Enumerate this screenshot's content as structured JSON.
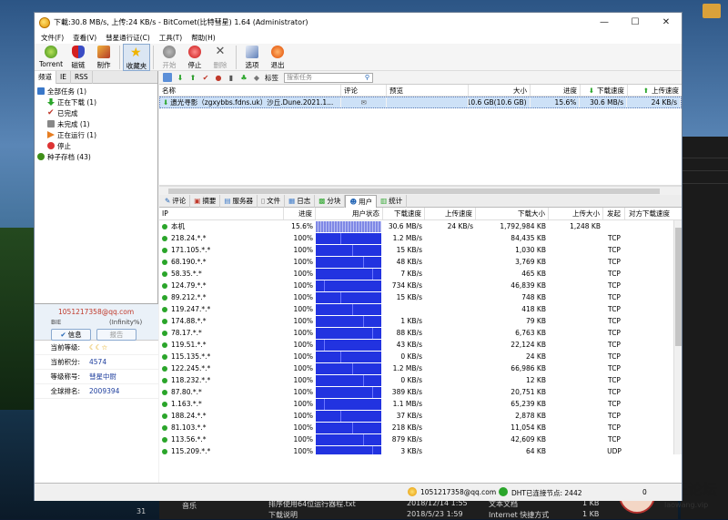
{
  "window": {
    "title": "下載:30.8 MB/s, 上传:24 KB/s - BitComet(比特彗星) 1.64 (Administrator)",
    "minimize": "—",
    "maximize": "☐",
    "close": "✕"
  },
  "menu": [
    "文件(F)",
    "查看(V)",
    "彗星通行证(C)",
    "工具(T)",
    "帮助(H)"
  ],
  "toolbar": [
    {
      "label": "Torrent",
      "icon": "torrent-icon"
    },
    {
      "label": "磁链",
      "icon": "magnet-icon"
    },
    {
      "label": "制作",
      "icon": "make-torrent-icon"
    },
    {
      "label": "收藏夹",
      "icon": "favorites-star-icon"
    },
    {
      "label": "开始",
      "icon": "start-icon"
    },
    {
      "label": "停止",
      "icon": "stop-icon"
    },
    {
      "label": "删除",
      "icon": "delete-icon"
    },
    {
      "label": "选项",
      "icon": "options-icon"
    },
    {
      "label": "退出",
      "icon": "exit-icon"
    }
  ],
  "left_tabs": [
    "频道",
    "IE",
    "RSS"
  ],
  "tree": [
    {
      "label": "全部任务 (1)",
      "level": 0
    },
    {
      "label": "正在下载 (1)",
      "level": 1
    },
    {
      "label": "已完成",
      "level": 1
    },
    {
      "label": "未完成 (1)",
      "level": 1
    },
    {
      "label": "正在运行 (1)",
      "level": 1
    },
    {
      "label": "停止",
      "level": 1
    },
    {
      "label": "种子存档 (43)",
      "level": 0
    }
  ],
  "user": {
    "email": "1051217358@qq.com",
    "nick_left": "BIE",
    "nick_right": "(Infinity%)",
    "info_btn": "信息",
    "report_btn": "报告",
    "stats": [
      {
        "k": "当前等级:",
        "v": "☾☾☆"
      },
      {
        "k": "当前积分:",
        "v": "4574"
      },
      {
        "k": "等级称号:",
        "v": "彗星中尉"
      },
      {
        "k": "全球排名:",
        "v": "2009394"
      }
    ]
  },
  "task_toolbar": {
    "tag_label": "标签",
    "search_placeholder": "搜索任务"
  },
  "task_columns": [
    "名称",
    "评论",
    "预览",
    "大小",
    "进度",
    "下载速度",
    "上传速度"
  ],
  "tasks": [
    {
      "name": "遗光寻影（zgxybbs.fdns.uk）沙丘.Dune.2021.1...",
      "comment": "✉",
      "preview": "",
      "size": "10.6 GB(10.6 GB)",
      "progress": "15.6%",
      "down": "30.6 MB/s",
      "up": "24 KB/s"
    }
  ],
  "bottom_tabs": [
    "评论",
    "摘要",
    "服务器",
    "文件",
    "日志",
    "分块",
    "用户",
    "统计"
  ],
  "peer_columns": [
    "IP",
    "进度",
    "用户状态",
    "下载速度",
    "上传速度",
    "下载大小",
    "上传大小",
    "发起",
    "对方下载速度"
  ],
  "peers": [
    {
      "ip": "本机",
      "progress": "15.6%",
      "fill": 1.0,
      "self": true,
      "down": "30.6 MB/s",
      "up": "24 KB/s",
      "dsize": "1,792,984 KB",
      "usize": "1,248 KB",
      "init": ""
    },
    {
      "ip": "218.24.*.*",
      "progress": "100%",
      "fill": 1.0,
      "down": "1.2 MB/s",
      "up": "",
      "dsize": "84,435 KB",
      "usize": "",
      "init": "TCP"
    },
    {
      "ip": "171.105.*.*",
      "progress": "100%",
      "fill": 1.0,
      "down": "15 KB/s",
      "up": "",
      "dsize": "1,030 KB",
      "usize": "",
      "init": "TCP"
    },
    {
      "ip": "68.190.*.*",
      "progress": "100%",
      "fill": 1.0,
      "down": "48 KB/s",
      "up": "",
      "dsize": "3,769 KB",
      "usize": "",
      "init": "TCP"
    },
    {
      "ip": "58.35.*.*",
      "progress": "100%",
      "fill": 1.0,
      "down": "7 KB/s",
      "up": "",
      "dsize": "465 KB",
      "usize": "",
      "init": "TCP"
    },
    {
      "ip": "124.79.*.*",
      "progress": "100%",
      "fill": 1.0,
      "down": "734 KB/s",
      "up": "",
      "dsize": "46,839 KB",
      "usize": "",
      "init": "TCP"
    },
    {
      "ip": "89.212.*.*",
      "progress": "100%",
      "fill": 1.0,
      "down": "15 KB/s",
      "up": "",
      "dsize": "748 KB",
      "usize": "",
      "init": "TCP"
    },
    {
      "ip": "119.247.*.*",
      "progress": "100%",
      "fill": 1.0,
      "down": "",
      "up": "",
      "dsize": "418 KB",
      "usize": "",
      "init": "TCP"
    },
    {
      "ip": "174.88.*.*",
      "progress": "100%",
      "fill": 1.0,
      "down": "1 KB/s",
      "up": "",
      "dsize": "79 KB",
      "usize": "",
      "init": "TCP"
    },
    {
      "ip": "78.17.*.*",
      "progress": "100%",
      "fill": 1.0,
      "down": "88 KB/s",
      "up": "",
      "dsize": "6,763 KB",
      "usize": "",
      "init": "TCP"
    },
    {
      "ip": "119.51.*.*",
      "progress": "100%",
      "fill": 1.0,
      "down": "43 KB/s",
      "up": "",
      "dsize": "22,124 KB",
      "usize": "",
      "init": "TCP"
    },
    {
      "ip": "115.135.*.*",
      "progress": "100%",
      "fill": 1.0,
      "down": "0 KB/s",
      "up": "",
      "dsize": "24 KB",
      "usize": "",
      "init": "TCP"
    },
    {
      "ip": "122.245.*.*",
      "progress": "100%",
      "fill": 1.0,
      "down": "1.2 MB/s",
      "up": "",
      "dsize": "66,986 KB",
      "usize": "",
      "init": "TCP"
    },
    {
      "ip": "118.232.*.*",
      "progress": "100%",
      "fill": 1.0,
      "down": "0 KB/s",
      "up": "",
      "dsize": "12 KB",
      "usize": "",
      "init": "TCP"
    },
    {
      "ip": "87.80.*.*",
      "progress": "100%",
      "fill": 1.0,
      "down": "389 KB/s",
      "up": "",
      "dsize": "20,751 KB",
      "usize": "",
      "init": "TCP"
    },
    {
      "ip": "1.163.*.*",
      "progress": "100%",
      "fill": 1.0,
      "down": "1.1 MB/s",
      "up": "",
      "dsize": "65,239 KB",
      "usize": "",
      "init": "TCP"
    },
    {
      "ip": "188.24.*.*",
      "progress": "100%",
      "fill": 1.0,
      "down": "37 KB/s",
      "up": "",
      "dsize": "2,878 KB",
      "usize": "",
      "init": "TCP"
    },
    {
      "ip": "81.103.*.*",
      "progress": "100%",
      "fill": 1.0,
      "down": "218 KB/s",
      "up": "",
      "dsize": "11,054 KB",
      "usize": "",
      "init": "TCP"
    },
    {
      "ip": "113.56.*.*",
      "progress": "100%",
      "fill": 1.0,
      "down": "879 KB/s",
      "up": "",
      "dsize": "42,609 KB",
      "usize": "",
      "init": "TCP"
    },
    {
      "ip": "115.209.*.*",
      "progress": "100%",
      "fill": 1.0,
      "down": "3 KB/s",
      "up": "",
      "dsize": "64 KB",
      "usize": "",
      "init": "UDP"
    }
  ],
  "status": {
    "email": "1051217358@qq.com",
    "dht": "DHT已连接节点: 2442",
    "right": "0"
  },
  "taskbar_rows": [
    {
      "a": "音乐",
      "b": "",
      "c": "",
      "d": ""
    },
    {
      "a": "排序使用64位运行器程.txt",
      "b": "2018/12/14 1:55",
      "c": "文本文档",
      "d": "1 KB"
    },
    {
      "a": "下载说明",
      "b": "2018/5/23 1:59",
      "c": "Internet 快捷方式",
      "d": "1 KB"
    }
  ],
  "side_num": "31",
  "watermark": {
    "title": "老王论坛",
    "sub": "laowang.vip"
  },
  "colors": {
    "bar_blue": "#2233e0",
    "selected_row": "#cde1f7",
    "accent": "#1f3f9e"
  }
}
